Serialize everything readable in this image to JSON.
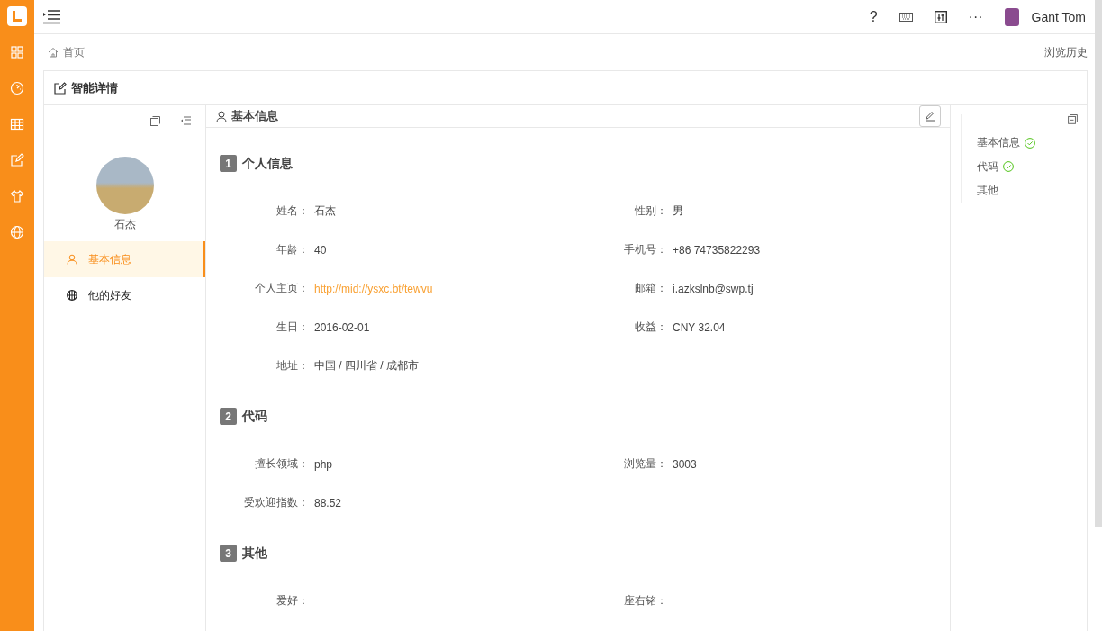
{
  "topbar": {
    "user_name": "Gant Tom",
    "actions": [
      {
        "kind": "help",
        "label": "?"
      },
      {
        "kind": "keyboard"
      },
      {
        "kind": "settings"
      },
      {
        "kind": "more",
        "label": "···"
      }
    ]
  },
  "sidebar": {
    "items": [
      {
        "kind": "grid",
        "selected": false
      },
      {
        "kind": "gauge",
        "selected": false
      },
      {
        "kind": "table",
        "selected": false
      },
      {
        "kind": "edit",
        "selected": false
      },
      {
        "kind": "shirt",
        "selected": false
      },
      {
        "kind": "globe",
        "selected": false
      }
    ]
  },
  "breadcrumb": {
    "home": "首页",
    "history": "浏览历史"
  },
  "card": {
    "title": "智能详情",
    "profile": {
      "name": "石杰"
    },
    "menu": [
      {
        "kind": "user",
        "label": "基本信息",
        "selected": true
      },
      {
        "kind": "globe",
        "label": "他的好友",
        "selected": false
      }
    ],
    "panel_title": "基本信息",
    "sections": [
      {
        "index": "1",
        "title": "个人信息",
        "fields": [
          {
            "label": "姓名：",
            "value": "石杰",
            "kind": "text"
          },
          {
            "label": "性别：",
            "value": "男",
            "kind": "text"
          },
          {
            "label": "年龄：",
            "value": "40",
            "kind": "text"
          },
          {
            "label": "手机号：",
            "value": "+86 74735822293",
            "kind": "text"
          },
          {
            "label": "个人主页：",
            "value": "http://mid://ysxc.bt/tewvu",
            "kind": "link"
          },
          {
            "label": "邮箱：",
            "value": "i.azkslnb@swp.tj",
            "kind": "text"
          },
          {
            "label": "生日：",
            "value": "2016-02-01",
            "kind": "text"
          },
          {
            "label": "收益：",
            "value": "CNY 32.04",
            "kind": "text"
          },
          {
            "label": "地址：",
            "value": "中国 / 四川省 / 成都市",
            "kind": "text"
          }
        ]
      },
      {
        "index": "2",
        "title": "代码",
        "fields": [
          {
            "label": "擅长领域：",
            "value": "php",
            "kind": "text"
          },
          {
            "label": "浏览量：",
            "value": "3003",
            "kind": "text"
          },
          {
            "label": "受欢迎指数：",
            "value": "88.52",
            "kind": "text"
          }
        ]
      },
      {
        "index": "3",
        "title": "其他",
        "fields": [
          {
            "label": "爱好：",
            "kind": "text"
          },
          {
            "label": "座右铭：",
            "kind": "text"
          }
        ]
      }
    ],
    "anchors": [
      {
        "label": "基本信息",
        "done": true
      },
      {
        "label": "代码",
        "done": true
      },
      {
        "label": "其他",
        "done": false
      }
    ]
  }
}
